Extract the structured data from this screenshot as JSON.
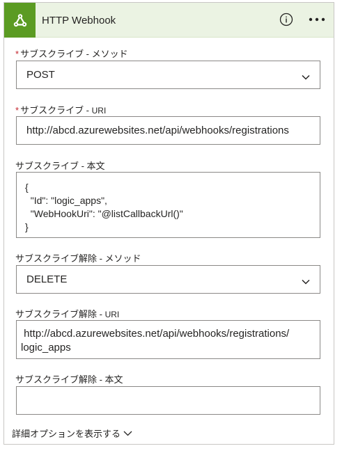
{
  "header": {
    "title": "HTTP Webhook",
    "icon": "webhook-icon",
    "accent_color": "#5b9b22",
    "background_color": "#ebf3e3"
  },
  "fields": {
    "subscribe_method": {
      "label": "サブスクライブ - メソッド",
      "required_mark": "*",
      "value": "POST"
    },
    "subscribe_uri": {
      "label_prefix": "サブスクライブ - ",
      "label_suffix": "URI",
      "required_mark": "*",
      "value": "http://abcd.azurewebsites.net/api/webhooks/registrations"
    },
    "subscribe_body": {
      "label": "サブスクライブ - 本文",
      "value": "{\n  \"Id\": \"logic_apps\",\n  \"WebHookUri\": \"@listCallbackUrl()\"\n}"
    },
    "unsubscribe_method": {
      "label": "サブスクライブ解除 - メソッド",
      "value": "DELETE"
    },
    "unsubscribe_uri": {
      "label_prefix": "サブスクライブ解除 - ",
      "label_suffix": "URI",
      "value": " http://abcd.azurewebsites.net/api/webhooks/registrations/\nlogic_apps"
    },
    "unsubscribe_body": {
      "label": "サブスクライブ解除 - 本文",
      "value": ""
    }
  },
  "advanced_options": {
    "label": "詳細オプションを表示する"
  },
  "colors": {
    "required": "#c4262e",
    "border": "#8a8886"
  }
}
